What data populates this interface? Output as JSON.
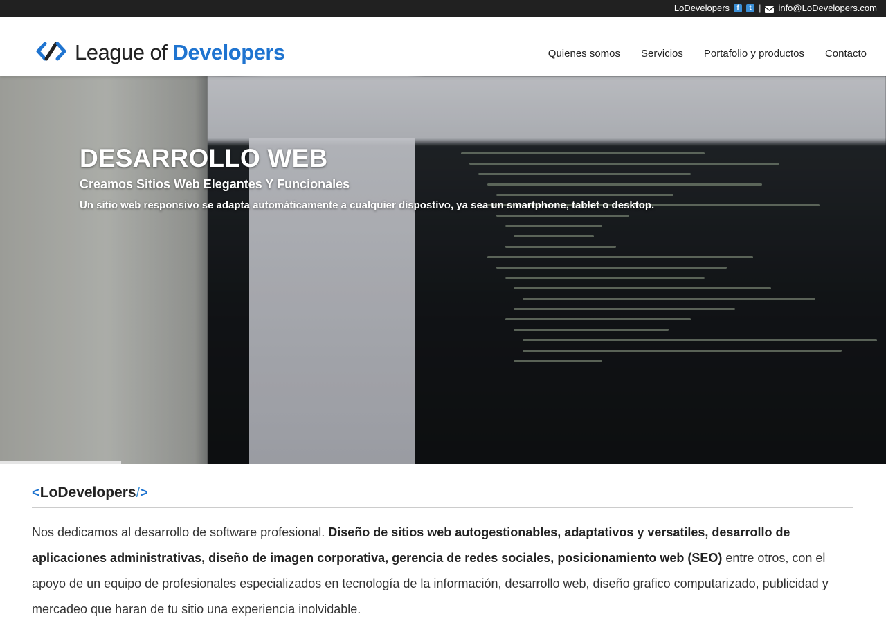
{
  "topbar": {
    "brand": "LoDevelopers",
    "facebook_icon": "facebook-square-icon",
    "twitter_icon": "twitter-square-icon",
    "separator": "|",
    "mail_icon": "envelope-icon",
    "email": "info@LoDevelopers.com"
  },
  "header": {
    "logo_icon": "code-chevrons-icon",
    "logo_part1": "League of ",
    "logo_part2": "Developers",
    "nav": [
      "Quienes somos",
      "Servicios",
      "Portafolio y productos",
      "Contacto"
    ]
  },
  "hero": {
    "title": "DESARROLLO WEB",
    "subtitle": "Creamos Sitios Web Elegantes Y Funcionales",
    "description": "Un sitio web responsivo se adapta automáticamente a cualquier dispostivo, ya sea un smartphone, tablet o desktop."
  },
  "about": {
    "title_prefix": "<",
    "title": "LoDevelopers",
    "title_suffix_slash": "/",
    "title_suffix": ">",
    "text_1": "Nos dedicamos al desarrollo de software profesional. ",
    "text_bold": "Diseño de sitios web autogestionables, adaptativos y versatiles, desarrollo de aplicaciones administrativas, diseño de imagen corporativa, gerencia de redes sociales, posicionamiento web (SEO)",
    "text_2": " entre otros, con el apoyo de un equipo de profesionales especializados en tecnología de la información, desarrollo web, diseño grafico computarizado, publicidad y mercadeo que haran de tu sitio una experiencia inolvidable."
  },
  "colors": {
    "topbar_bg": "#212121",
    "brand_blue": "#1f74d0",
    "accent_blue": "#3b8fd6"
  }
}
